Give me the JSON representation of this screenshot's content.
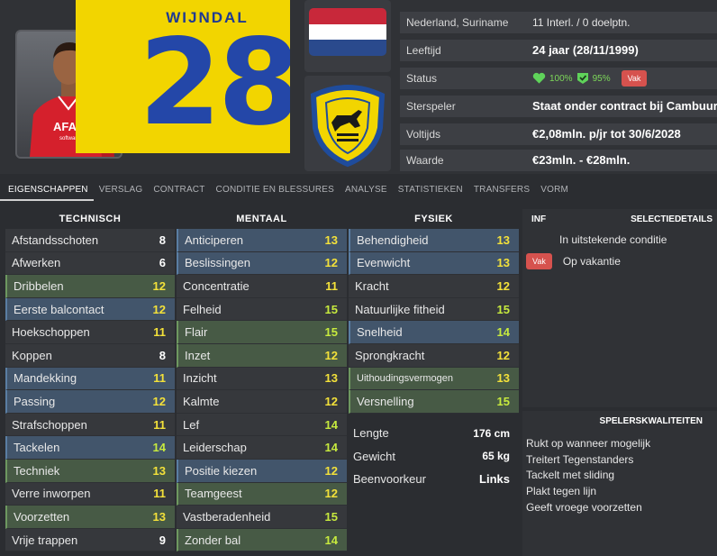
{
  "player": {
    "shirt_name": "WIJNDAL",
    "shirt_number": "28",
    "photo_sponsor": "AFAS",
    "photo_sponsor_sub": "software"
  },
  "info": {
    "nationality": "Nederland, Suriname",
    "caps": "11 Interl. / 0 doelptn.",
    "age_label": "Leeftijd",
    "age_value": "24 jaar (28/11/1999)",
    "status_label": "Status",
    "status_condition": "100%",
    "status_sharpness": "95%",
    "status_badge": "Vak",
    "star_label": "Sterspeler",
    "star_value": "Staat onder contract bij Cambuur",
    "wage_label": "Voltijds",
    "wage_value": "€2,08mln. p/jr tot 30/6/2028",
    "value_label": "Waarde",
    "value_value": "€23mln. - €28mln."
  },
  "colors": {
    "accent_green": "#7dd85a",
    "badge_red": "#d6524e",
    "value_yellow": "#f3e13a",
    "value_lime": "#c7ea3e",
    "jersey_yellow": "#f2d500",
    "jersey_blue": "#2447a8"
  },
  "tabs": [
    "EIGENSCHAPPEN",
    "VERSLAG",
    "CONTRACT",
    "CONDITIE EN BLESSURES",
    "ANALYSE",
    "STATISTIEKEN",
    "TRANSFERS",
    "VORM"
  ],
  "technical": {
    "title": "TECHNISCH",
    "attrs": [
      {
        "name": "Afstandsschoten",
        "value": "8",
        "hl": "plain",
        "color": "white"
      },
      {
        "name": "Afwerken",
        "value": "6",
        "hl": "plain",
        "color": "white"
      },
      {
        "name": "Dribbelen",
        "value": "12",
        "hl": "green",
        "color": "yellow"
      },
      {
        "name": "Eerste balcontact",
        "value": "12",
        "hl": "blue",
        "color": "yellow"
      },
      {
        "name": "Hoekschoppen",
        "value": "11",
        "hl": "plain",
        "color": "yellow"
      },
      {
        "name": "Koppen",
        "value": "8",
        "hl": "plain",
        "color": "white"
      },
      {
        "name": "Mandekking",
        "value": "11",
        "hl": "blue",
        "color": "yellow"
      },
      {
        "name": "Passing",
        "value": "12",
        "hl": "blue",
        "color": "yellow"
      },
      {
        "name": "Strafschoppen",
        "value": "11",
        "hl": "plain",
        "color": "yellow"
      },
      {
        "name": "Tackelen",
        "value": "14",
        "hl": "blue",
        "color": "lime"
      },
      {
        "name": "Techniek",
        "value": "13",
        "hl": "green",
        "color": "yellow"
      },
      {
        "name": "Verre inworpen",
        "value": "11",
        "hl": "plain",
        "color": "yellow"
      },
      {
        "name": "Voorzetten",
        "value": "13",
        "hl": "green",
        "color": "yellow"
      },
      {
        "name": "Vrije trappen",
        "value": "9",
        "hl": "plain",
        "color": "white"
      }
    ]
  },
  "mental": {
    "title": "MENTAAL",
    "attrs": [
      {
        "name": "Anticiperen",
        "value": "13",
        "hl": "blue",
        "color": "yellow"
      },
      {
        "name": "Beslissingen",
        "value": "12",
        "hl": "blue",
        "color": "yellow"
      },
      {
        "name": "Concentratie",
        "value": "11",
        "hl": "plain",
        "color": "yellow"
      },
      {
        "name": "Felheid",
        "value": "15",
        "hl": "plain",
        "color": "lime"
      },
      {
        "name": "Flair",
        "value": "15",
        "hl": "green",
        "color": "lime"
      },
      {
        "name": "Inzet",
        "value": "12",
        "hl": "green",
        "color": "yellow"
      },
      {
        "name": "Inzicht",
        "value": "13",
        "hl": "plain",
        "color": "yellow"
      },
      {
        "name": "Kalmte",
        "value": "12",
        "hl": "plain",
        "color": "yellow"
      },
      {
        "name": "Lef",
        "value": "14",
        "hl": "plain",
        "color": "lime"
      },
      {
        "name": "Leiderschap",
        "value": "14",
        "hl": "plain",
        "color": "lime"
      },
      {
        "name": "Positie kiezen",
        "value": "12",
        "hl": "blue",
        "color": "yellow"
      },
      {
        "name": "Teamgeest",
        "value": "12",
        "hl": "green",
        "color": "yellow"
      },
      {
        "name": "Vastberadenheid",
        "value": "15",
        "hl": "plain",
        "color": "lime"
      },
      {
        "name": "Zonder bal",
        "value": "14",
        "hl": "green",
        "color": "lime"
      }
    ]
  },
  "physical": {
    "title": "FYSIEK",
    "attrs": [
      {
        "name": "Behendigheid",
        "value": "13",
        "hl": "blue",
        "color": "yellow"
      },
      {
        "name": "Evenwicht",
        "value": "13",
        "hl": "blue",
        "color": "yellow"
      },
      {
        "name": "Kracht",
        "value": "12",
        "hl": "plain",
        "color": "yellow"
      },
      {
        "name": "Natuurlijke fitheid",
        "value": "15",
        "hl": "plain",
        "color": "lime"
      },
      {
        "name": "Snelheid",
        "value": "14",
        "hl": "blue",
        "color": "lime"
      },
      {
        "name": "Sprongkracht",
        "value": "12",
        "hl": "plain",
        "color": "yellow"
      },
      {
        "name": "Uithoudingsvermogen",
        "value": "13",
        "hl": "green",
        "color": "yellow",
        "narrow": true
      },
      {
        "name": "Versnelling",
        "value": "15",
        "hl": "green",
        "color": "lime"
      }
    ]
  },
  "bio": {
    "height_label": "Lengte",
    "height_value": "176 cm",
    "weight_label": "Gewicht",
    "weight_value": "65 kg",
    "foot_label": "Beenvoorkeur",
    "foot_value": "Links"
  },
  "selection": {
    "inf_label": "INF",
    "title": "SELECTIEDETAILS",
    "condition_text": "In uitstekende conditie",
    "vacation_badge": "Vak",
    "vacation_text": "Op vakantie"
  },
  "qualities": {
    "title": "SPELERSKWALITEITEN",
    "items": [
      "Rukt op wanneer mogelijk",
      "Treitert Tegenstanders",
      "Tackelt met sliding",
      "Plakt tegen lijn",
      "Geeft vroege voorzetten"
    ]
  }
}
